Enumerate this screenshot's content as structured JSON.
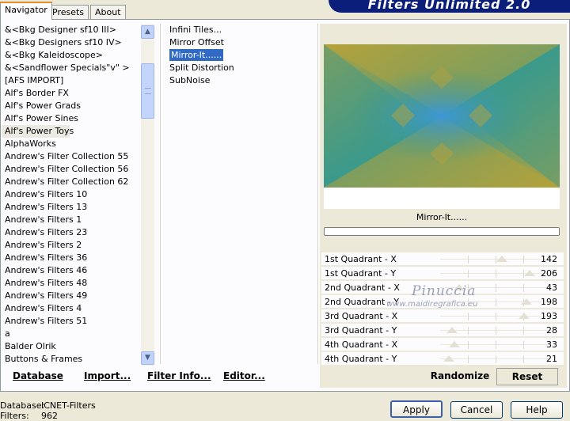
{
  "app_title": "Filters Unlimited 2.0",
  "tabs": [
    {
      "label": "Navigator"
    },
    {
      "label": "Presets"
    },
    {
      "label": "About"
    }
  ],
  "categories": [
    "&<Bkg Designer sf10 III>",
    "&<Bkg Designers sf10 IV>",
    "&<Bkg Kaleidoscope>",
    "&<Sandflower Specials\"v\" >",
    "[AFS IMPORT]",
    "Alf's Border FX",
    "Alf's Power Grads",
    "Alf's Power Sines",
    "Alf's Power Toys",
    "AlphaWorks",
    "Andrew's Filter Collection 55",
    "Andrew's Filter Collection 56",
    "Andrew's Filter Collection 62",
    "Andrew's Filters 10",
    "Andrew's Filters 13",
    "Andrew's Filters 1",
    "Andrew's Filters 23",
    "Andrew's Filters 2",
    "Andrew's Filters 36",
    "Andrew's Filters 46",
    "Andrew's Filters 48",
    "Andrew's Filters 49",
    "Andrew's Filters 4",
    "Andrew's Filters 51",
    "a",
    "Balder Olrik",
    "Buttons & Frames"
  ],
  "selected_category_index": 8,
  "filters": [
    "Infini Tiles...",
    "Mirror Offset",
    "Mirror-It......",
    "Split Distortion",
    "SubNoise"
  ],
  "selected_filter_index": 2,
  "selected_filter_name": "Mirror-It......",
  "params": [
    {
      "label": "1st Quadrant - X",
      "value": "142",
      "level": 0.557
    },
    {
      "label": "1st Quadrant - Y",
      "value": "206",
      "level": 0.808
    },
    {
      "label": "2nd Quadrant - X",
      "value": "43",
      "level": 0.169
    },
    {
      "label": "2nd Quadrant - Y",
      "value": "198",
      "level": 0.776
    },
    {
      "label": "3rd Quadrant - X",
      "value": "193",
      "level": 0.757
    },
    {
      "label": "3rd Quadrant - Y",
      "value": "28",
      "level": 0.11
    },
    {
      "label": "4th Quadrant - X",
      "value": "33",
      "level": 0.129
    },
    {
      "label": "4th Quadrant - Y",
      "value": "21",
      "level": 0.082
    }
  ],
  "watermark": {
    "name": "Pinuccia",
    "url": "www.maidiregrafica.eu"
  },
  "buttons": {
    "database": "Database",
    "import": "Import...",
    "filter_info": "Filter Info...",
    "editor": "Editor...",
    "randomize": "Randomize",
    "reset": "Reset",
    "apply": "Apply",
    "cancel": "Cancel",
    "help": "Help"
  },
  "footer": {
    "database_label": "Database:",
    "database_value": "ICNET-Filters",
    "filters_label": "Filters:",
    "filters_value": "962"
  },
  "colors": {
    "banner": "#0a1e7a",
    "selection": "#316ac5",
    "preview_gold": "#b5a23b",
    "preview_teal": "#3a9a8c",
    "preview_blue": "#3e97d6"
  }
}
